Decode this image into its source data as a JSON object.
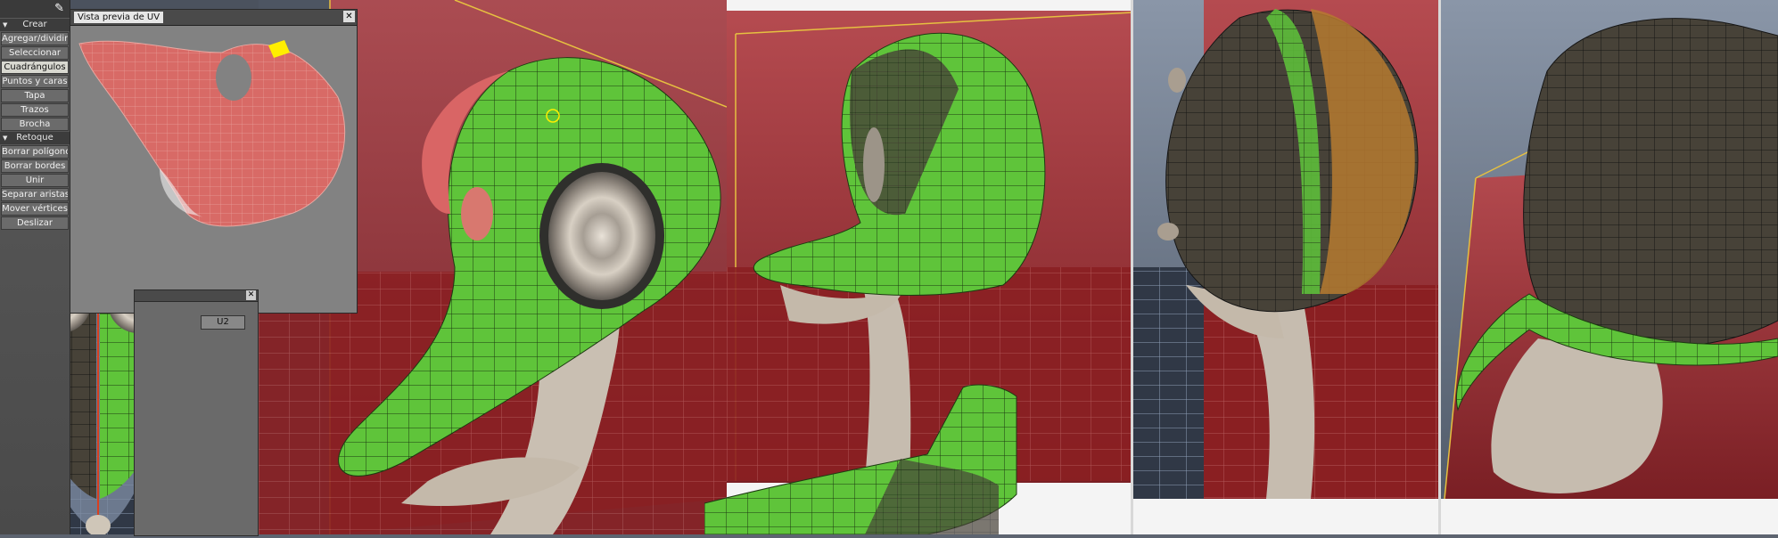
{
  "toolbar": {
    "sections": [
      {
        "label": "Crear",
        "buttons": [
          "Agregar/dividir",
          "Seleccionar",
          "Cuadrángulos",
          "Puntos y caras",
          "Tapa",
          "Trazos",
          "Brocha"
        ],
        "active": "Cuadrángulos"
      },
      {
        "label": "Retoque",
        "buttons": [
          "Borrar polígonos",
          "Borrar bordes",
          "Unir",
          "Separar aristas",
          "Mover vértices",
          "Deslizar"
        ]
      }
    ]
  },
  "uv_window": {
    "title": "Vista previa de UV",
    "close_label": "✕"
  },
  "small_window": {
    "close_label": "✕",
    "field_value": "U2"
  },
  "colors": {
    "wire_green": "#5fc43a",
    "mesh_gray": "#c6bcaf",
    "uv_red": "#d96565",
    "floor_red": "#8a1f22",
    "panel_gray": "#5a5a5a",
    "selection_yellow": "#ffee00",
    "border_yellow": "#e6c040"
  },
  "icons": [
    "brush-icon",
    "close-icon"
  ]
}
